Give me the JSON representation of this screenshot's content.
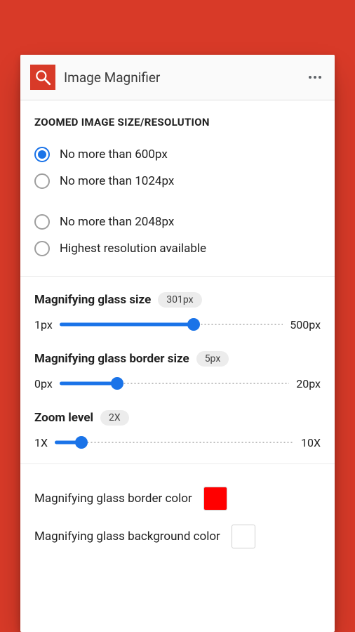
{
  "header": {
    "title": "Image Magnifier"
  },
  "resolution": {
    "title": "ZOOMED IMAGE SIZE/RESOLUTION",
    "options": [
      {
        "label": "No more than 600px",
        "checked": true,
        "gap": false
      },
      {
        "label": "No more than 1024px",
        "checked": false,
        "gap": false
      },
      {
        "label": "No more than 2048px",
        "checked": false,
        "gap": true
      },
      {
        "label": "Highest resolution available",
        "checked": false,
        "gap": false
      }
    ]
  },
  "sliders": {
    "glass_size": {
      "title": "Magnifying glass size",
      "badge": "301px",
      "min_label": "1px",
      "max_label": "500px",
      "min": 1,
      "max": 500,
      "value": 301
    },
    "border_size": {
      "title": "Magnifying glass border size",
      "badge": "5px",
      "min_label": "0px",
      "max_label": "20px",
      "min": 0,
      "max": 20,
      "value": 5
    },
    "zoom": {
      "title": "Zoom level",
      "badge": "2X",
      "min_label": "1X",
      "max_label": "10X",
      "min": 1,
      "max": 10,
      "value": 2
    }
  },
  "colors": {
    "border": {
      "label": "Magnifying glass border color",
      "value": "#ff0000"
    },
    "background": {
      "label": "Magnifying glass background color",
      "value": "#ffffff"
    }
  }
}
